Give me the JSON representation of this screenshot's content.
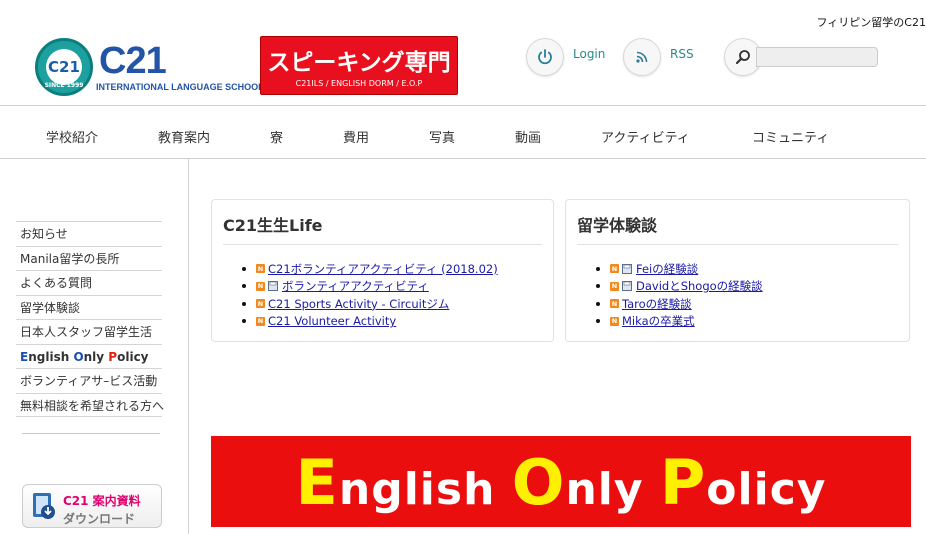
{
  "header": {
    "tagline": "フィリピン留学のC21",
    "logo": {
      "badge_text": "C21",
      "badge_ring_text": "SINCE 1999",
      "mark": "C21",
      "school_name": "INTERNATIONAL LANGUAGE SCHOOL"
    },
    "banner": {
      "title": "スピーキング専門",
      "subtitle": "C21ILS / ENGLISH DORM / E.O.P"
    },
    "login_label": "Login",
    "rss_label": "RSS",
    "search_placeholder": ""
  },
  "nav": [
    "学校紹介",
    "教育案内",
    "寮",
    "費用",
    "写真",
    "動画",
    "アクティビティ",
    "コミュニティ"
  ],
  "sidebar": {
    "items": [
      "お知らせ",
      "Manila留学の長所",
      "よくある質問",
      "留学体験談",
      "日本人スタッフ留学生活"
    ],
    "eop": {
      "e1": "E",
      "r1": "nglish ",
      "e2": "O",
      "r2": "nly ",
      "e3": "P",
      "r3": "olicy"
    },
    "items_after": [
      "ボランティアサ–ビス活動",
      "無料相談を希望される方へ"
    ],
    "download": {
      "line1": "C21 案内資料",
      "line2": "ダウンロード"
    }
  },
  "box_life": {
    "title": "C21生生Life",
    "posts": [
      {
        "text": "C21ボランティアアクティビティ (2018.02)",
        "badge": "N",
        "file": false
      },
      {
        "text": "ボランティアアクティビティ",
        "badge": "N",
        "file": true
      },
      {
        "text": "C21 Sports Activity - Circuitジム",
        "badge": "N",
        "file": false
      },
      {
        "text": "C21 Volunteer Activity",
        "badge": "N",
        "file": false
      }
    ]
  },
  "box_stories": {
    "title": "留学体験談",
    "posts": [
      {
        "text": "Feiの経験談",
        "badge": "N",
        "file": true
      },
      {
        "text": "DavidとShogoの経験談",
        "badge": "N",
        "file": true
      },
      {
        "text": "Taroの経験談",
        "badge": "N",
        "file": false
      },
      {
        "text": "Mikaの卒業式",
        "badge": "N",
        "file": false
      }
    ]
  },
  "eop_banner": {
    "c1": "E",
    "t1": "nglish ",
    "c2": "O",
    "t2": "nly ",
    "c3": "P",
    "t3": "olicy"
  },
  "colors": {
    "accent_red": "#e8101e",
    "brand_blue": "#2254a8",
    "link": "#1a1aa6",
    "teal": "#2a8a8a"
  },
  "icons": [
    "power-icon",
    "rss-icon",
    "search-icon",
    "new-badge-icon",
    "file-icon",
    "download-book-icon"
  ]
}
